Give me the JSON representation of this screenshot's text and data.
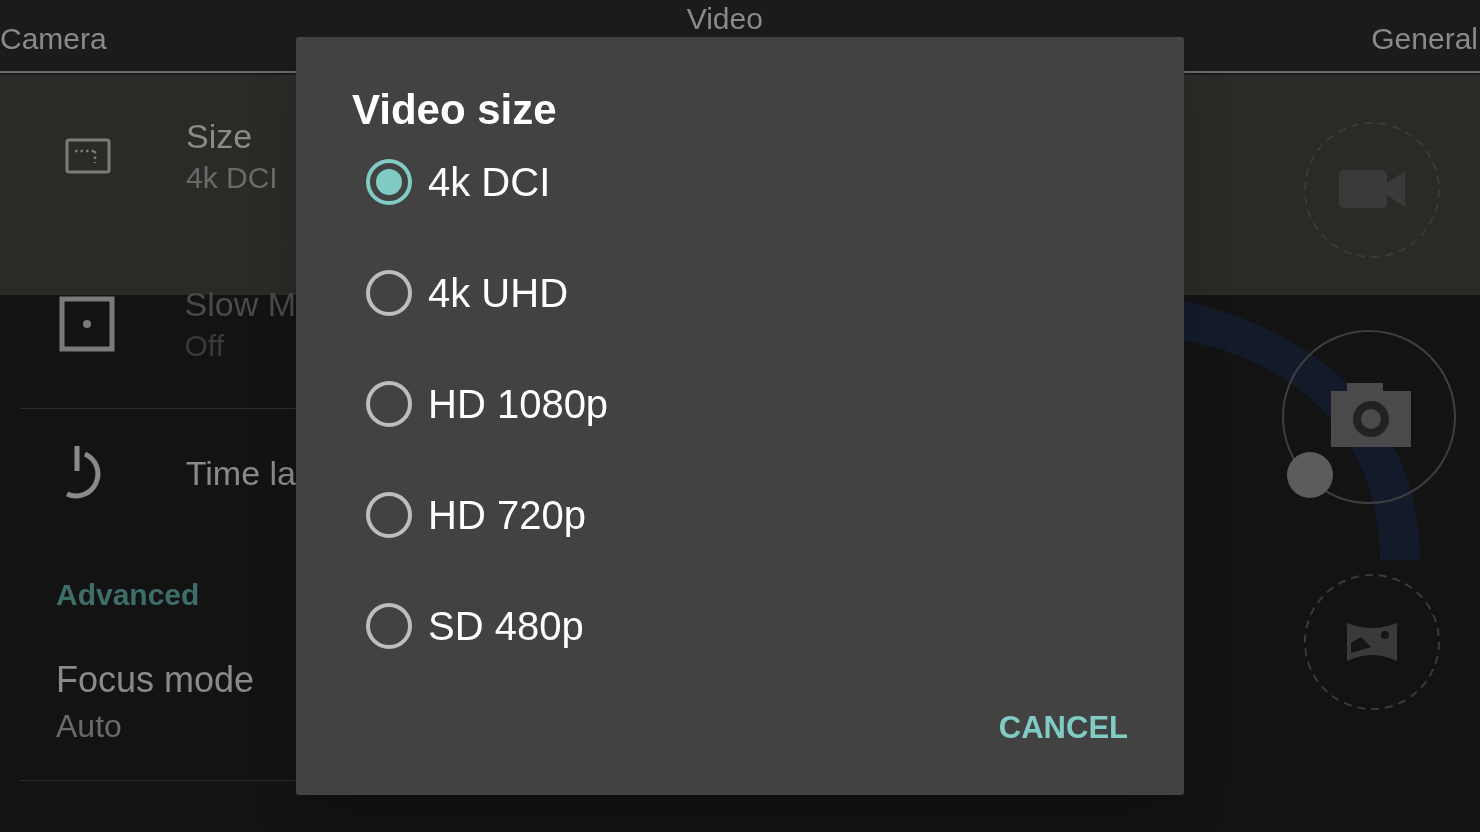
{
  "header": {
    "tabs": [
      "Camera",
      "Video",
      "General"
    ]
  },
  "settings": [
    {
      "kind": "row",
      "title": "Size",
      "value": "4k DCI",
      "disabled": false
    },
    {
      "kind": "row",
      "title": "Slow M",
      "value": "Off",
      "disabled": true
    },
    {
      "kind": "row",
      "title": "Time la",
      "disabled": false
    },
    {
      "kind": "section",
      "title": "Advanced"
    },
    {
      "kind": "plain",
      "title": "Focus mode",
      "value": "Auto"
    }
  ],
  "dialog": {
    "title": "Video size",
    "options": [
      {
        "label": "4k DCI",
        "selected": true
      },
      {
        "label": "4k UHD",
        "selected": false
      },
      {
        "label": "HD 1080p",
        "selected": false
      },
      {
        "label": "HD 720p",
        "selected": false
      },
      {
        "label": "SD 480p",
        "selected": false
      }
    ],
    "buttons": [
      "CANCEL"
    ]
  }
}
